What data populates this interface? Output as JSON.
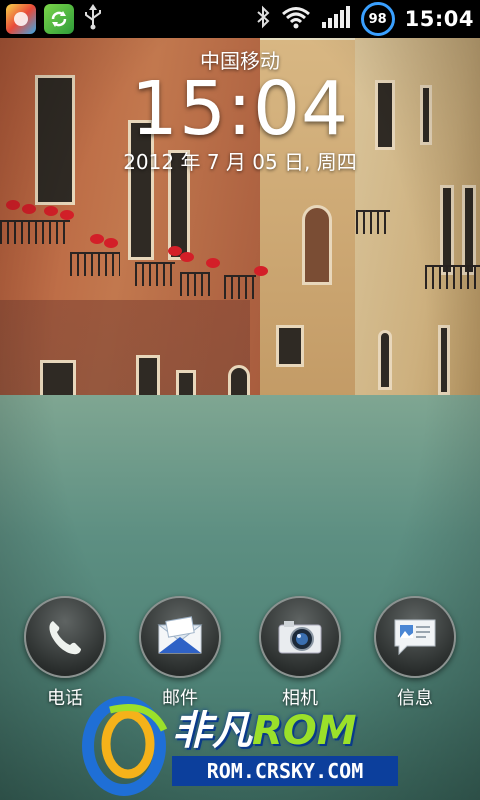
{
  "status_bar": {
    "left_icons": [
      "weather-app-icon",
      "sync-app-icon",
      "usb-icon"
    ],
    "right_icons": [
      "bluetooth-icon",
      "wifi-icon",
      "signal-icon"
    ],
    "battery_level": "98",
    "time": "15:04",
    "accent_color": "#3aa0ff"
  },
  "lock": {
    "carrier": "中国移动",
    "clock": "15:04",
    "date": "2012 年 7 月 05 日, 周四"
  },
  "dock": [
    {
      "label": "电话",
      "icon": "phone-icon"
    },
    {
      "label": "邮件",
      "icon": "mail-icon"
    },
    {
      "label": "相机",
      "icon": "camera-icon"
    },
    {
      "label": "信息",
      "icon": "messages-icon"
    }
  ],
  "watermark": {
    "brand_prefix": "非凡",
    "brand_suffix": "ROM",
    "url": "ROM.CRSKY.COM"
  }
}
